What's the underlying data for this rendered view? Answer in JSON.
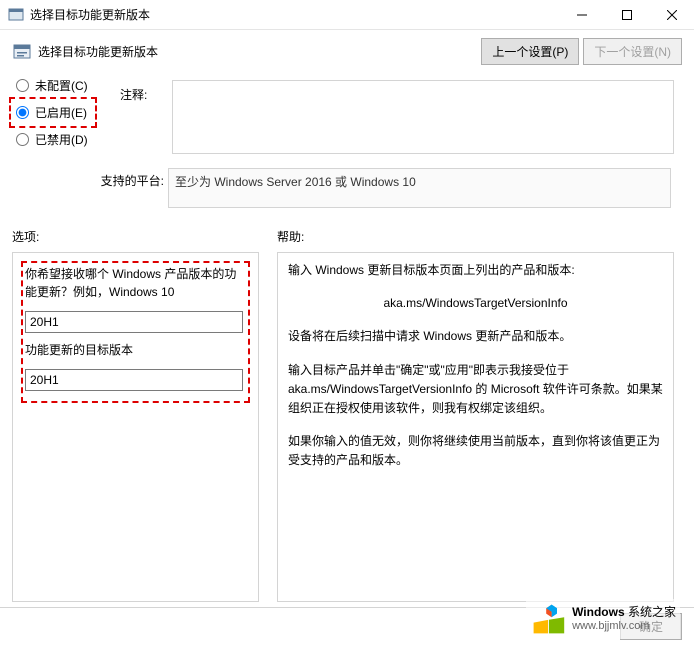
{
  "window": {
    "title": "选择目标功能更新版本"
  },
  "header": {
    "title": "选择目标功能更新版本",
    "prev_setting": "上一个设置(P)",
    "next_setting": "下一个设置(N)"
  },
  "radio": {
    "not_configured": "未配置(C)",
    "enabled": "已启用(E)",
    "disabled": "已禁用(D)"
  },
  "labels": {
    "comment": "注释:",
    "platform": "支持的平台:",
    "options": "选项:",
    "help": "帮助:"
  },
  "platform": {
    "text": "至少为 Windows Server 2016 或 Windows 10"
  },
  "options": {
    "q1": "你希望接收哪个 Windows 产品版本的功能更新？例如，Windows 10",
    "input1": "20H1",
    "q2": "功能更新的目标版本",
    "input2": "20H1"
  },
  "help": {
    "p1": "输入 Windows 更新目标版本页面上列出的产品和版本:",
    "p1a": "aka.ms/WindowsTargetVersionInfo",
    "p2": "设备将在后续扫描中请求 Windows 更新产品和版本。",
    "p3": "输入目标产品并单击\"确定\"或\"应用\"即表示我接受位于 aka.ms/WindowsTargetVersionInfo 的 Microsoft 软件许可条款。如果某组织正在授权使用该软件，则我有权绑定该组织。",
    "p4": "如果你输入的值无效，则你将继续使用当前版本，直到你将该值更正为受支持的产品和版本。"
  },
  "buttons": {
    "ok": "确定"
  },
  "watermark": {
    "brand": "Windows",
    "site": "系统之家",
    "url": "www.bjjmlv.com"
  }
}
